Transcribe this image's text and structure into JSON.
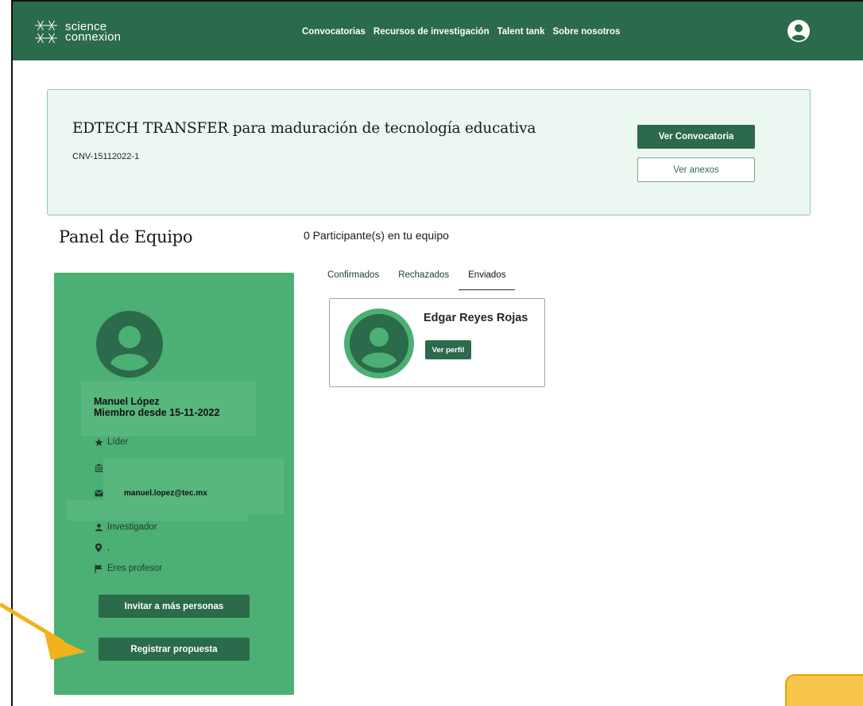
{
  "header": {
    "logo_line1": "science",
    "logo_line2": "connexion",
    "nav": [
      "Convocatorias",
      "Recursos de investigación",
      "Talent tank",
      "Sobre nosotros"
    ]
  },
  "call": {
    "title": "EDTECH TRANSFER para maduración de tecnología educativa",
    "code": "CNV-15112022-1",
    "view_call_label": "Ver Convocatoria",
    "view_annex_label": "Ver anexos"
  },
  "panel": {
    "title": "Panel de Equipo",
    "participants_count": "0 Participante(s) en tu equipo"
  },
  "member": {
    "name": "Manuel López",
    "member_since": "Miembro desde 15-11-2022",
    "role": "Líder",
    "institution": "",
    "email": "manuel.lopez@tec.mx",
    "profile_type": "Investigador",
    "location": ",",
    "teacher": "Eres profesor",
    "invite_label": "Invitar a más personas",
    "register_label": "Registrar propuesta"
  },
  "tabs": [
    "Confirmados",
    "Rechazados",
    "Enviados"
  ],
  "active_tab": "Enviados",
  "participant": {
    "name": "Edgar Reyes Rojas",
    "profile_label": "Ver perfil"
  },
  "colors": {
    "brand_dark": "#2b6a4a",
    "brand_green": "#4caf73",
    "call_bg": "#edf7f1",
    "annotation": "#f2b21b"
  }
}
